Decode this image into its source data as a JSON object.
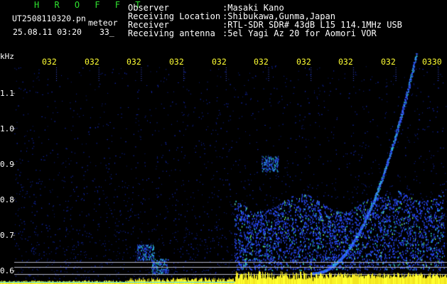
{
  "header": {
    "brand": "H R O F F T",
    "filename": "UT2508110320.pn",
    "type_label": "meteor",
    "datetime": "25.08.11 03:20",
    "count": "33_",
    "meta": [
      {
        "label": "Observer",
        "value": ":Masaki Kano"
      },
      {
        "label": "Receiving Location",
        "value": ":Shibukawa,Gunma,Japan"
      },
      {
        "label": "Receiver",
        "value": ":RTL-SDR SDR# 43dB L15 114.1MHz USB"
      },
      {
        "label": "Receiving antenna",
        "value": ":5el Yagi Az 20 for Aomori VOR"
      }
    ]
  },
  "axes": {
    "y_unit": "kHz",
    "y_ticks": [
      "1.1",
      "1.0",
      "0.9",
      "0.8",
      "0.7",
      "0.6"
    ],
    "x_ticks": [
      "032",
      "032",
      "032",
      "032",
      "032",
      "032",
      "032",
      "032",
      "032",
      "0330"
    ]
  },
  "colors": {
    "background": "#000000",
    "noise": "#1a2fd0",
    "signal_mid": "#2fd0d0",
    "signal_high": "#ffff30",
    "brand": "#2fe02f",
    "ticks": "#ffff33"
  }
}
